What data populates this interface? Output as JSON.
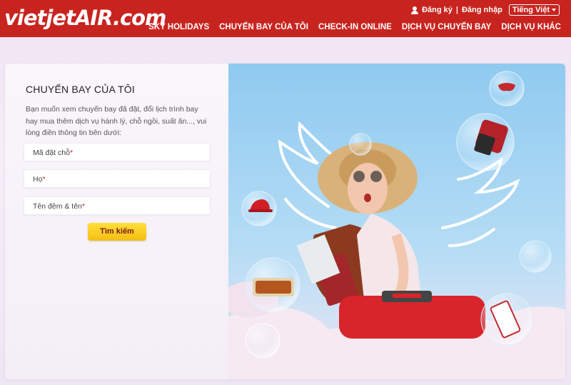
{
  "header": {
    "logo_text": "vietjetAIR.com",
    "register_label": "Đăng ký",
    "separator": "|",
    "login_label": "Đăng nhập",
    "language_label": "Tiếng Việt"
  },
  "nav": {
    "items": [
      "SKY HOLIDAYS",
      "CHUYẾN BAY CỦA TÔI",
      "CHECK-IN ONLINE",
      "DỊCH VỤ CHUYẾN BAY",
      "DỊCH VỤ KHÁC"
    ]
  },
  "form": {
    "title": "CHUYẾN BAY CỦA TÔI",
    "description": "Bạn muốn xem chuyến bay đã đặt, đổi lịch trình bay hay mua thêm dịch vụ hành lý, chỗ ngồi, suất ăn..., vui lòng điền thông tin bên dưới:",
    "fields": [
      {
        "label": "Mã đặt chỗ",
        "required": "*"
      },
      {
        "label": "Họ",
        "required": "*"
      },
      {
        "label": "Tên đệm & tên",
        "required": "*"
      }
    ],
    "submit_label": "Tìm kiếm"
  },
  "colors": {
    "brand_red": "#c8241f",
    "button_yellow": "#f7c51e",
    "sky_blue": "#9fd3f1"
  }
}
